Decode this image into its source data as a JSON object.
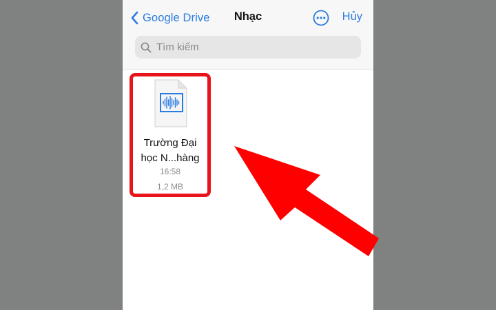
{
  "nav": {
    "back_label": "Google Drive",
    "title": "Nhạc",
    "cancel_label": "Hủy",
    "accent_color": "#2b7ce0"
  },
  "search": {
    "placeholder": "Tìm kiếm",
    "value": ""
  },
  "files": [
    {
      "name_line1": "Trường Đại",
      "name_line2": "học N...hàng",
      "time": "16:58",
      "size": "1,2 MB",
      "icon": "audio-waveform-icon"
    }
  ],
  "annotation": {
    "highlight_color": "#e8141b",
    "arrow_color": "#ff0000"
  }
}
